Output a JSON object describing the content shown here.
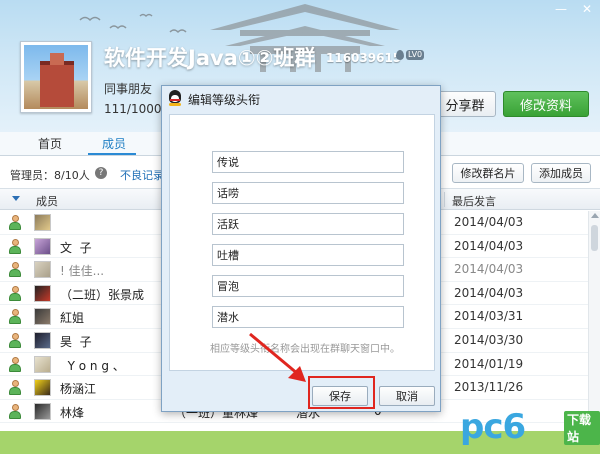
{
  "header": {
    "title": "软件开发Java①②班群",
    "group_id": "116039615",
    "level_badge": "LV0",
    "subtitle": "同事朋友",
    "member_count": "111/1000",
    "share_label": "分享群",
    "edit_label": "修改资料"
  },
  "tabs": [
    {
      "label": "首页"
    },
    {
      "label": "成员"
    }
  ],
  "toolbar": {
    "admin_count": "管理员：8/10人",
    "bad_record": "不良记录",
    "edit_card": "修改群名片",
    "add_member": "添加成员"
  },
  "table": {
    "col_member": "成员",
    "col_last": "最后发言",
    "rows": [
      {
        "nick": "",
        "card": "",
        "level": "",
        "points": "",
        "date": "2014/04/03",
        "gray": false
      },
      {
        "nick": "文  子",
        "card": "",
        "level": "",
        "points": "",
        "date": "2014/04/03",
        "gray": false
      },
      {
        "nick": "! 佳佳...",
        "card": "",
        "level": "",
        "points": "",
        "date": "2014/04/03",
        "gray": true
      },
      {
        "nick": "（二班）张景成",
        "card": "",
        "level": "",
        "points": "",
        "date": "2014/04/03",
        "gray": false
      },
      {
        "nick": "紅姐",
        "card": "",
        "level": "",
        "points": "",
        "date": "2014/03/31",
        "gray": false
      },
      {
        "nick": "昊  子",
        "card": "",
        "level": "",
        "points": "",
        "date": "2014/03/30",
        "gray": false
      },
      {
        "nick": "  Y o n g 、",
        "card": "",
        "level": "",
        "points": "",
        "date": "2014/01/19",
        "gray": false
      },
      {
        "nick": "杨涵江",
        "card": "",
        "level": "",
        "points": "",
        "date": "2013/11/26",
        "gray": false
      },
      {
        "nick": "林烽",
        "card": "（一班）董林烽",
        "level": "潜水",
        "points": "0",
        "date": "",
        "gray": false
      }
    ]
  },
  "dialog": {
    "title": "编辑等级头衔",
    "levels": [
      "传说",
      "话唠",
      "活跃",
      "吐槽",
      "冒泡",
      "潜水"
    ],
    "hint": "相应等级头衔名称会出现在群聊天窗口中。",
    "save_label": "保存",
    "cancel_label": "取消"
  },
  "logo": {
    "text": "pc6",
    "badge": "下载站"
  },
  "colors": {
    "accent": "#2b8ad4",
    "edit_button": "#39a236",
    "highlight": "#e0261f"
  }
}
